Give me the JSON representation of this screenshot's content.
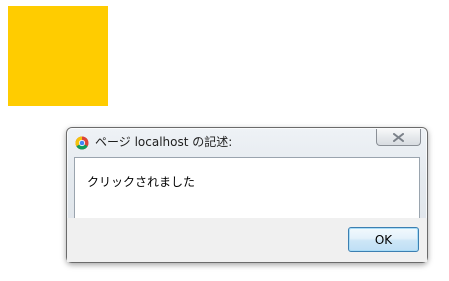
{
  "page": {
    "yellow_box_color": "#ffcc00"
  },
  "dialog": {
    "title": "ページ localhost の記述:",
    "title_icon": "chrome-icon",
    "close_icon": "close-icon",
    "message": "クリックされました",
    "ok_label": "OK"
  }
}
